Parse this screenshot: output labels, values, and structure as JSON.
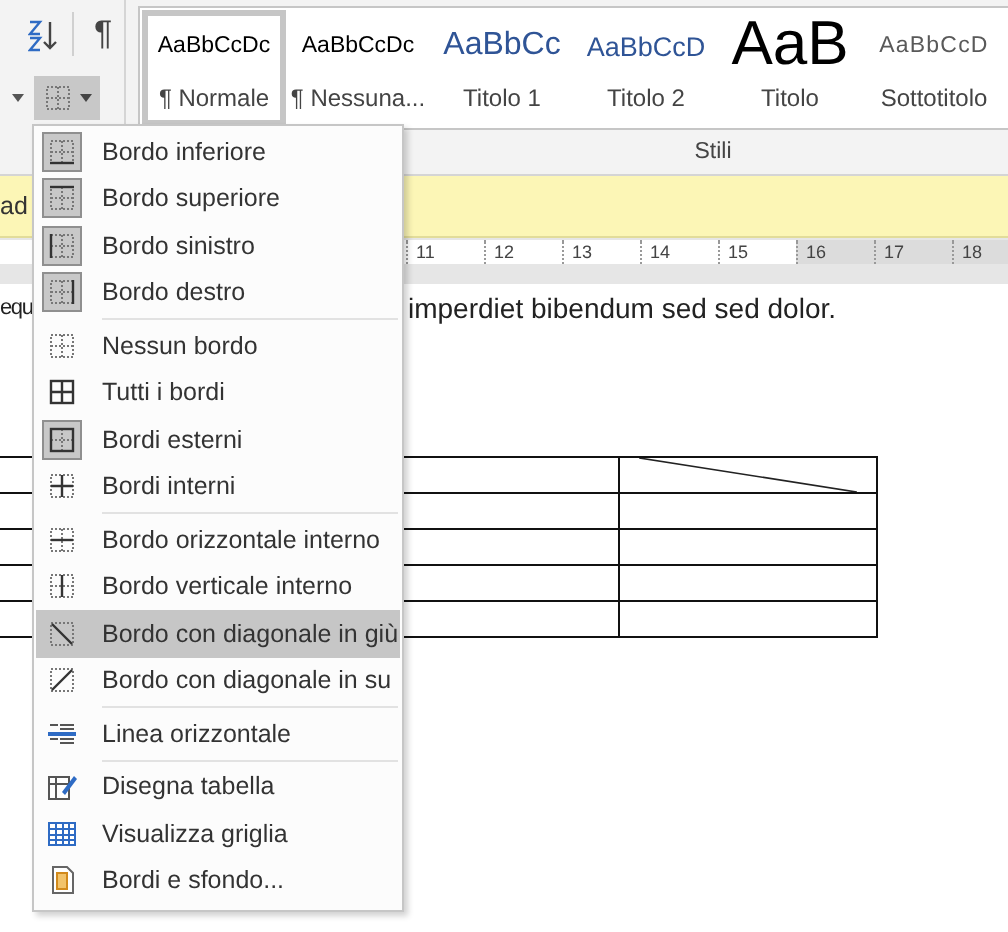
{
  "ribbon": {
    "paragraph_marks": "¶",
    "styles": [
      {
        "preview": "AaBbCcDc",
        "label": "¶ Normale",
        "kind": "normal",
        "selected": true
      },
      {
        "preview": "AaBbCcDc",
        "label": "¶ Nessuna...",
        "kind": "normal",
        "selected": false
      },
      {
        "preview": "AaBbCc",
        "label": "Titolo 1",
        "kind": "heading1",
        "selected": false
      },
      {
        "preview": "AaBbCcD",
        "label": "Titolo 2",
        "kind": "heading2",
        "selected": false
      },
      {
        "preview": "AaB",
        "label": "Titolo",
        "kind": "title",
        "selected": false
      },
      {
        "preview": "AaBbCcD",
        "label": "Sottotitolo",
        "kind": "subtitle",
        "selected": false
      }
    ],
    "group_label": "Stili"
  },
  "message_bar": {
    "text": "ad"
  },
  "ruler": {
    "numbers": [
      "11",
      "12",
      "13",
      "14",
      "15",
      "16",
      "17",
      "18"
    ]
  },
  "document": {
    "text_left": "equ",
    "text_right": "imperdiet bibendum sed sed dolor."
  },
  "menu": {
    "items": [
      {
        "label": "Bordo inferiore",
        "kind": "bottom",
        "checked": true,
        "highlighted": false,
        "separator_after": false
      },
      {
        "label": "Bordo superiore",
        "kind": "top",
        "checked": true,
        "highlighted": false,
        "separator_after": false
      },
      {
        "label": "Bordo sinistro",
        "kind": "left",
        "checked": true,
        "highlighted": false,
        "separator_after": false
      },
      {
        "label": "Bordo destro",
        "kind": "right",
        "checked": true,
        "highlighted": false,
        "separator_after": true
      },
      {
        "label": "Nessun bordo",
        "kind": "none",
        "checked": false,
        "highlighted": false,
        "separator_after": false
      },
      {
        "label": "Tutti i bordi",
        "kind": "all",
        "checked": false,
        "highlighted": false,
        "separator_after": false
      },
      {
        "label": "Bordi esterni",
        "kind": "outside",
        "checked": true,
        "highlighted": false,
        "separator_after": false
      },
      {
        "label": "Bordi interni",
        "kind": "inside",
        "checked": false,
        "highlighted": false,
        "separator_after": true
      },
      {
        "label": "Bordo orizzontale interno",
        "kind": "inside-h",
        "checked": false,
        "highlighted": false,
        "separator_after": false
      },
      {
        "label": "Bordo verticale interno",
        "kind": "inside-v",
        "checked": false,
        "highlighted": false,
        "separator_after": false
      },
      {
        "label": "Bordo con diagonale in giù",
        "kind": "diag-down",
        "checked": false,
        "highlighted": true,
        "separator_after": false
      },
      {
        "label": "Bordo con diagonale in su",
        "kind": "diag-up",
        "checked": false,
        "highlighted": false,
        "separator_after": true
      },
      {
        "label": "Linea orizzontale",
        "kind": "hline",
        "checked": false,
        "highlighted": false,
        "separator_after": true
      },
      {
        "label": "Disegna tabella",
        "kind": "draw",
        "checked": false,
        "highlighted": false,
        "separator_after": false
      },
      {
        "label": "Visualizza griglia",
        "kind": "grid",
        "checked": false,
        "highlighted": false,
        "separator_after": false
      },
      {
        "label": "Bordi e sfondo...",
        "kind": "page",
        "checked": false,
        "highlighted": false,
        "separator_after": false
      }
    ]
  }
}
